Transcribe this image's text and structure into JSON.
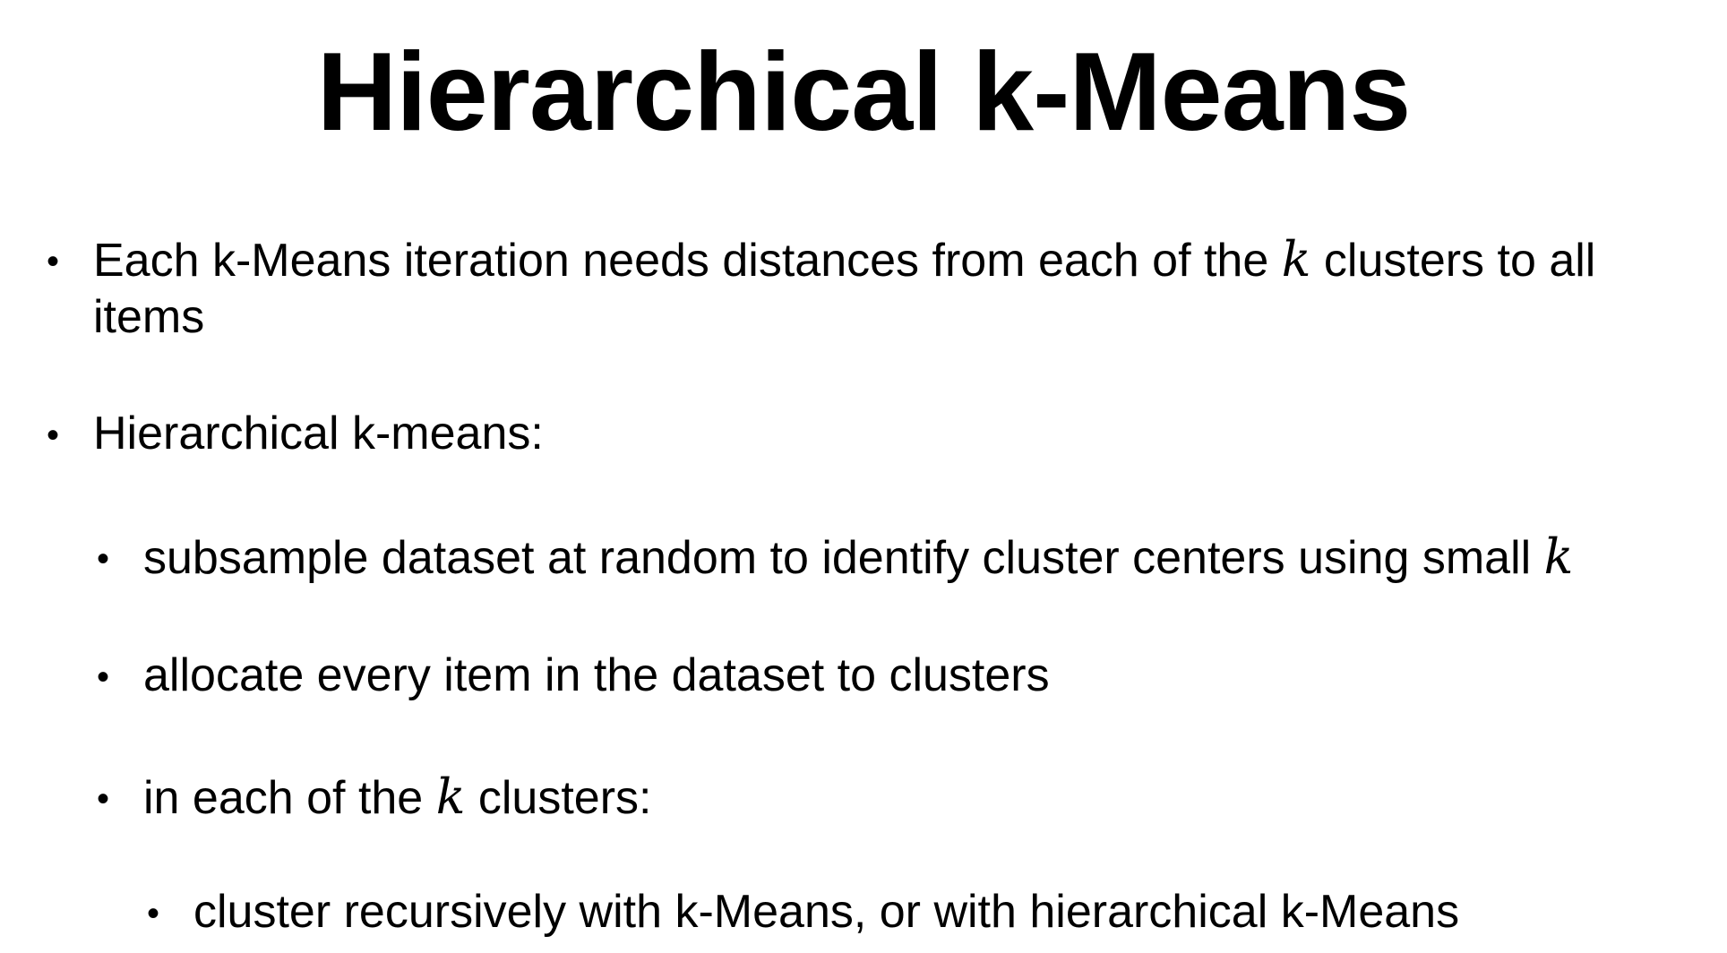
{
  "title": "Hierarchical k-Means",
  "bullets": {
    "b1": {
      "line1_a": "Each k-Means iteration needs distances from each of the ",
      "k": "k",
      "line1_b": " clusters to all",
      "line2": "items"
    },
    "b2": {
      "text": "Hierarchical k-means:"
    },
    "b2_1": {
      "text_a": "subsample dataset at random to identify cluster centers using small ",
      "k": "k"
    },
    "b2_2": {
      "text": "allocate every item in the dataset to clusters"
    },
    "b2_3": {
      "text_a": "in each of the ",
      "k": "k",
      "text_b": " clusters:"
    },
    "b2_3_1": {
      "text": "cluster recursively with k-Means, or with hierarchical k-Means"
    }
  },
  "bullet_glyph": "•"
}
